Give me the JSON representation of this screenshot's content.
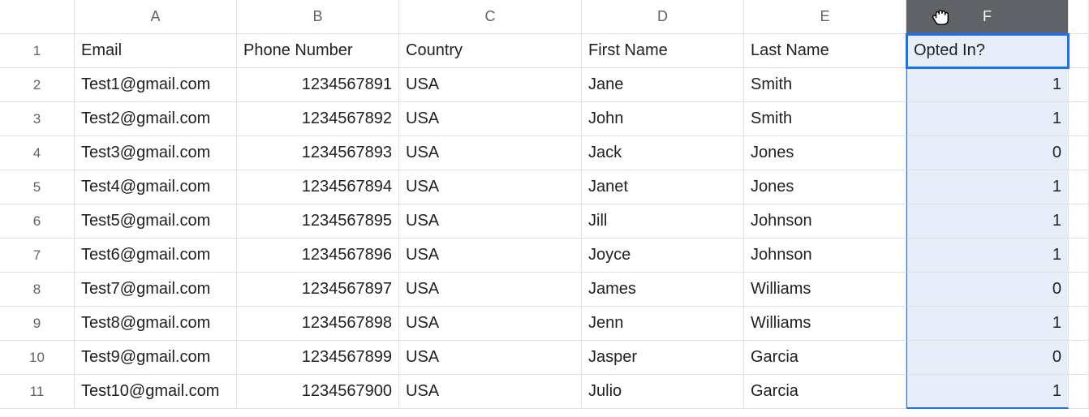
{
  "columns": [
    "A",
    "B",
    "C",
    "D",
    "E",
    "F"
  ],
  "selected_column_index": 5,
  "active_cell": "F1",
  "headers": [
    "Email",
    "Phone Number",
    "Country",
    "First Name",
    "Last Name",
    "Opted In?"
  ],
  "rows": [
    {
      "n": 1
    },
    {
      "n": 2,
      "email": "Test1@gmail.com",
      "phone": "1234567891",
      "country": "USA",
      "first": "Jane",
      "last": "Smith",
      "opted": "1"
    },
    {
      "n": 3,
      "email": "Test2@gmail.com",
      "phone": "1234567892",
      "country": "USA",
      "first": "John",
      "last": "Smith",
      "opted": "1"
    },
    {
      "n": 4,
      "email": "Test3@gmail.com",
      "phone": "1234567893",
      "country": "USA",
      "first": "Jack",
      "last": "Jones",
      "opted": "0"
    },
    {
      "n": 5,
      "email": "Test4@gmail.com",
      "phone": "1234567894",
      "country": "USA",
      "first": "Janet",
      "last": "Jones",
      "opted": "1"
    },
    {
      "n": 6,
      "email": "Test5@gmail.com",
      "phone": "1234567895",
      "country": "USA",
      "first": "Jill",
      "last": "Johnson",
      "opted": "1"
    },
    {
      "n": 7,
      "email": "Test6@gmail.com",
      "phone": "1234567896",
      "country": "USA",
      "first": "Joyce",
      "last": "Johnson",
      "opted": "1"
    },
    {
      "n": 8,
      "email": "Test7@gmail.com",
      "phone": "1234567897",
      "country": "USA",
      "first": "James",
      "last": "Williams",
      "opted": "0"
    },
    {
      "n": 9,
      "email": "Test8@gmail.com",
      "phone": "1234567898",
      "country": "USA",
      "first": "Jenn",
      "last": "Williams",
      "opted": "1"
    },
    {
      "n": 10,
      "email": "Test9@gmail.com",
      "phone": "1234567899",
      "country": "USA",
      "first": "Jasper",
      "last": "Garcia",
      "opted": "0"
    },
    {
      "n": 11,
      "email": "Test10@gmail.com",
      "phone": "1234567900",
      "country": "USA",
      "first": "Julio",
      "last": "Garcia",
      "opted": "1"
    }
  ],
  "cursor_icon_name": "open-hand"
}
